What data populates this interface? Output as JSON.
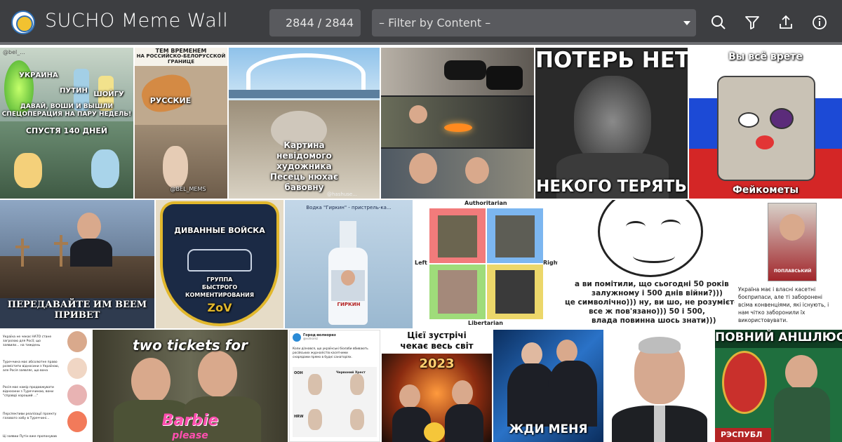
{
  "header": {
    "title": "SUCHO Meme Wall",
    "counter": "2844 / 2844",
    "filter_placeholder": "– Filter by Content –",
    "colors": {
      "bar": "#3d3e41",
      "field": "#595a5e",
      "text": "#ffffff"
    },
    "icons": [
      "logo-icon",
      "search-icon",
      "filter-icon",
      "upload-icon",
      "info-icon"
    ]
  },
  "memes": {
    "m1": {
      "top_left": "УКРАИНА",
      "top_mid": "ПУТИН",
      "top_right": "ШОЙГУ",
      "line1": "ДАВАЙ, ВОШИ И ВЫШЛИ",
      "line2": "СПЕЦОПЕРАЦИЯ НА ПАРУ НЕДЕЛЬ!",
      "line3": "СПУСТЯ 140 ДНЕЙ",
      "corner": "@bel_..."
    },
    "m2": {
      "top": "ТЕМ ВРЕМЕНЕМ",
      "sub1": "НА РОССИЙСКО-БЕЛОРУССКОЙ",
      "sub2": "ГРАНИЦЕ",
      "label": "РУССКИЕ",
      "watermark": "@BEL_MEMS"
    },
    "m3": {
      "l1": "Картина",
      "l2": "невідомого",
      "l3": "художника",
      "l4": "Песець нюхає",
      "l5": "бавовну",
      "credit": "@hashuse..."
    },
    "m5": {
      "top": "ПОТЕРЬ НЕТ",
      "bottom": "НЕКОГО ТЕРЯТЬ"
    },
    "m6": {
      "top": "Вы всё врете",
      "bottom": "Фейкометы"
    },
    "m7": {
      "l1": "ПЕРЕДАВАЙТЕ ИМ ВЕЕМ",
      "l2": "ПРИВЕТ"
    },
    "m8": {
      "l1": "ДИВАННЫЕ ВОЙСКА",
      "l2": "ГРУППА",
      "l3": "БЫСТРОГО",
      "l4": "КОММЕНТИРОВАНИЯ",
      "l5": "ZoV"
    },
    "m9": {
      "top": "Водка \"Гиркин\" - пристрель-ка...",
      "label": "ГИРКИН"
    },
    "m10": {
      "top": "Authoritarian",
      "bottom": "Libertarian",
      "left": "Left",
      "right": "Right"
    },
    "m11": {
      "l1": "а ви помітили, що сьогодні 50 років",
      "l2": "залужному і 500 днів війни?)))",
      "l3": "це символічно))) ну, ви шо, не розумієте,",
      "l4": "все ж пов'язано))) 50 і 500,",
      "l5": "влада повинна шось знати)))"
    },
    "m12": {
      "cassette": "ПОПЛАВСЬКИЙ",
      "l1": "Україна має і власні касетні",
      "l2": "боєприпаси, але ті заборонені",
      "l3": "всіма конвенціями, які існують, і",
      "l4": "нам чітко заборонили їх",
      "l5": "використовувати."
    },
    "m13": {
      "p1": "Україна не чекає НАТО стане",
      "p1b": "загрозою для Росії; що",
      "p1c": "заявили... на тиждень",
      "p2": "Туреччина має абсолютне право",
      "p2b": "розмістити відносини з Україною,",
      "p2c": "але Росія заявляє, що вона",
      "p3": "Росія має намір продовжувати",
      "p3b": "відносини з Туреччиною, вони",
      "p3c": "\"справді хороший ...\"",
      "p4": "Перспективи реалізації проекту",
      "p4b": "газового хабу в Туреччині...",
      "p5": "Ці заявки Путін вже пропонував"
    },
    "m14": {
      "top": "two tickets for",
      "bottom": "Barbie",
      "extra": "please"
    },
    "m15": {
      "channel": "Город-волнорез",
      "handle": "@volnorez",
      "body1": "Коли дізнався, що українські біолаби вбивають",
      "body2": "російських журналістів касетними",
      "body3": "снарядами прямо в будні санаторіях.",
      "a": "ООН",
      "b": "Червоний Хрест",
      "c": "HRW"
    },
    "m16": {
      "l1": "Цієї зустрічі",
      "l2": "чекає весь світ",
      "year": "2023"
    },
    "m17": {
      "bottom": "ЖДИ МЕНЯ"
    },
    "m19": {
      "top": "ПОВНИЙ АНШЛЮС",
      "bottom": "РЭСПУБЛ"
    }
  }
}
